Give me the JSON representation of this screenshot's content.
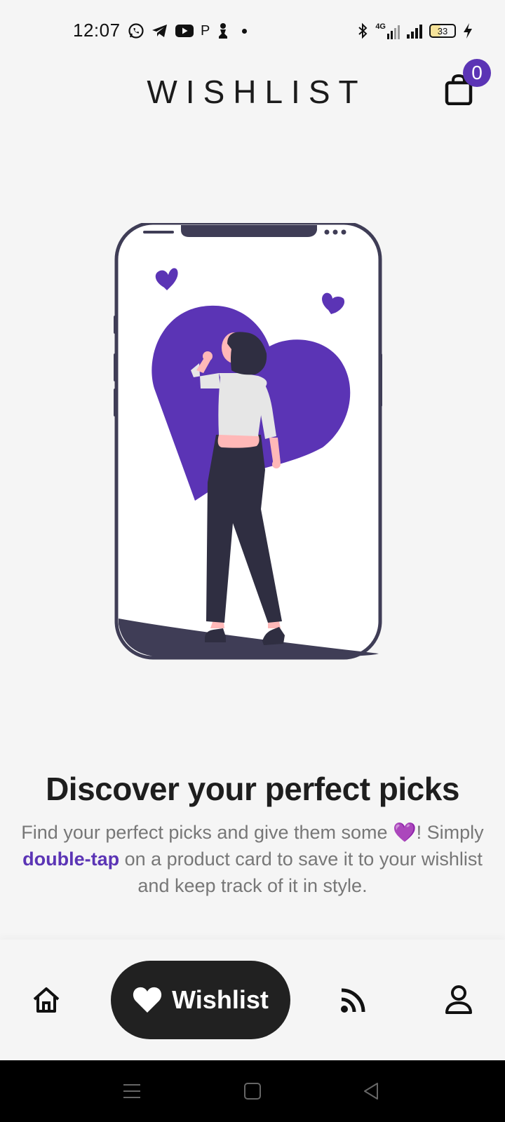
{
  "status_bar": {
    "time": "12:07",
    "left_icons": [
      "whatsapp-icon",
      "telegram-icon",
      "youtube-icon",
      "p-icon",
      "chess-pawn-icon",
      "dot"
    ],
    "p_glyph": "P",
    "network_label": "4G",
    "battery_level": "33",
    "right_icons": [
      "bluetooth-icon",
      "signal-4g-icon",
      "signal-icon",
      "battery-icon",
      "charging-icon"
    ]
  },
  "header": {
    "title": "WISHLIST",
    "cart_count": "0"
  },
  "content": {
    "headline": "Discover your perfect picks",
    "description_part1": "Find your perfect picks and give them some 💜! Simply ",
    "description_highlight": "double-tap",
    "description_part2": " on a product card to save it to your wishlist and keep track of it in style."
  },
  "bottom_nav": {
    "items": [
      {
        "icon": "home-icon",
        "label": ""
      },
      {
        "icon": "heart-icon",
        "label": "Wishlist",
        "active": true
      },
      {
        "icon": "rss-feed-icon",
        "label": ""
      },
      {
        "icon": "user-icon",
        "label": ""
      }
    ]
  },
  "colors": {
    "accent": "#5b34b5",
    "background": "#f5f5f5",
    "active_pill": "#212121",
    "phone_frame": "#3f3d56",
    "figure_dark": "#2f2e41",
    "skin": "#ffb8b8"
  },
  "system_nav": [
    "menu-icon",
    "home-square-icon",
    "back-triangle-icon"
  ]
}
